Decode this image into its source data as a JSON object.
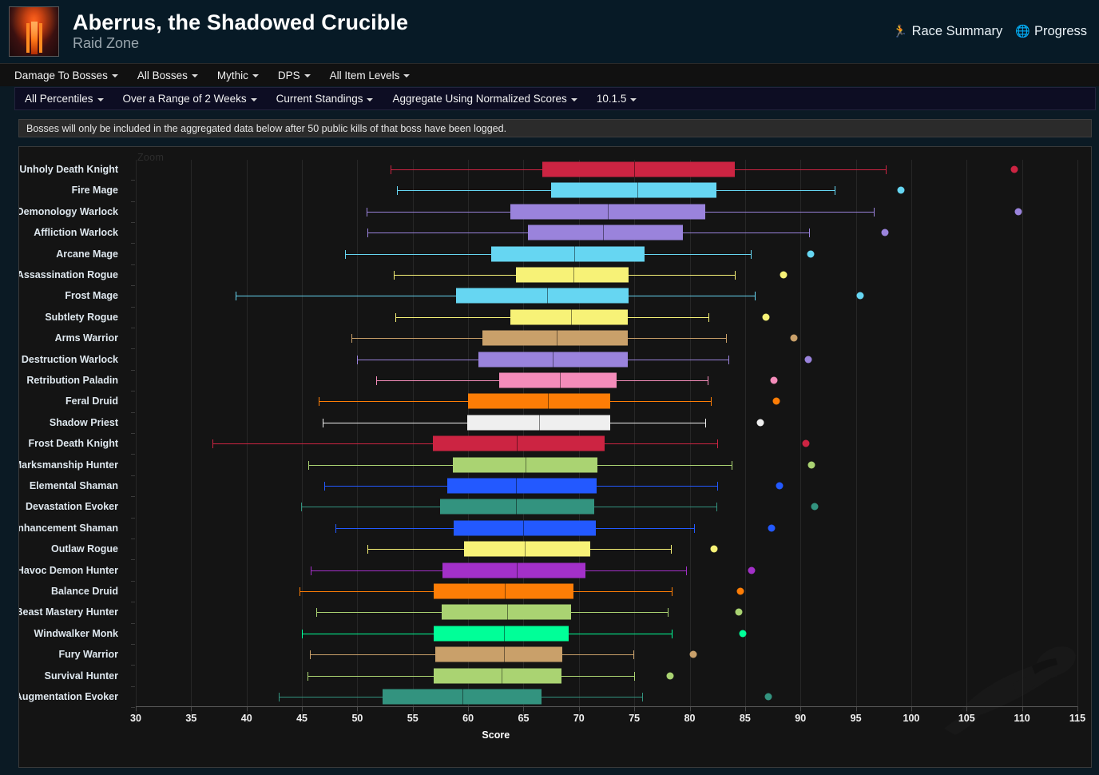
{
  "header": {
    "title": "Aberrus, the Shadowed Crucible",
    "subtitle": "Raid Zone",
    "zone_icon": "raid-zone-icon",
    "links": [
      {
        "label": "Race Summary",
        "icon": "runner-icon",
        "glyph": "🏃"
      },
      {
        "label": "Progress",
        "icon": "globe-icon",
        "glyph": "🌐"
      }
    ]
  },
  "filters_primary": [
    {
      "label": "Damage To Bosses"
    },
    {
      "label": "All Bosses"
    },
    {
      "label": "Mythic"
    },
    {
      "label": "DPS"
    },
    {
      "label": "All Item Levels"
    }
  ],
  "filters_secondary": [
    {
      "label": "All Percentiles"
    },
    {
      "label": "Over a Range of 2 Weeks"
    },
    {
      "label": "Current Standings"
    },
    {
      "label": "Aggregate Using Normalized Scores"
    },
    {
      "label": "10.1.5"
    }
  ],
  "notice": "Bosses will only be included in the aggregated data below after 50 public kills of that boss have been logged.",
  "chart_controls": {
    "zoom_label": "Zoom"
  },
  "chart_data": {
    "type": "box",
    "title": "",
    "xlabel": "Score",
    "ylabel": "",
    "xlim": [
      30,
      115
    ],
    "xticks": [
      30,
      35,
      40,
      45,
      50,
      55,
      60,
      65,
      70,
      75,
      80,
      85,
      90,
      95,
      100,
      105,
      110,
      115
    ],
    "grid": true,
    "legend": "none",
    "orientation": "horizontal",
    "categories": [
      "Unholy Death Knight",
      "Fire Mage",
      "Demonology Warlock",
      "Affliction Warlock",
      "Arcane Mage",
      "Assassination Rogue",
      "Frost Mage",
      "Subtlety Rogue",
      "Arms Warrior",
      "Destruction Warlock",
      "Retribution Paladin",
      "Feral Druid",
      "Shadow Priest",
      "Frost Death Knight",
      "Marksmanship Hunter",
      "Elemental Shaman",
      "Devastation Evoker",
      "Enhancement Shaman",
      "Outlaw Rogue",
      "Havoc Demon Hunter",
      "Balance Druid",
      "Beast Mastery Hunter",
      "Windwalker Monk",
      "Fury Warrior",
      "Survival Hunter",
      "Augmentation Evoker"
    ],
    "series": [
      {
        "name": "Unholy Death Knight",
        "color": "#cc2442",
        "low": 53.0,
        "q1": 66.7,
        "median": 75.0,
        "q3": 84.1,
        "high": 97.7,
        "outliers": [
          109.3
        ]
      },
      {
        "name": "Fire Mage",
        "color": "#66d6f2",
        "low": 53.6,
        "q1": 67.5,
        "median": 75.3,
        "q3": 82.4,
        "high": 93.1,
        "outliers": [
          99.1
        ]
      },
      {
        "name": "Demonology Warlock",
        "color": "#9a83dc",
        "low": 50.8,
        "q1": 63.8,
        "median": 72.6,
        "q3": 81.4,
        "high": 96.6,
        "outliers": [
          109.7
        ]
      },
      {
        "name": "Affliction Warlock",
        "color": "#9a83dc",
        "low": 50.9,
        "q1": 65.4,
        "median": 72.2,
        "q3": 79.4,
        "high": 90.8,
        "outliers": [
          97.6
        ]
      },
      {
        "name": "Arcane Mage",
        "color": "#66d6f2",
        "low": 48.9,
        "q1": 62.1,
        "median": 69.6,
        "q3": 75.9,
        "high": 85.5,
        "outliers": [
          90.9
        ]
      },
      {
        "name": "Assassination Rogue",
        "color": "#f7f277",
        "low": 53.3,
        "q1": 64.3,
        "median": 69.5,
        "q3": 74.5,
        "high": 84.1,
        "outliers": [
          88.5
        ]
      },
      {
        "name": "Frost Mage",
        "color": "#66d6f2",
        "low": 39.0,
        "q1": 58.9,
        "median": 67.1,
        "q3": 74.5,
        "high": 85.9,
        "outliers": [
          95.4
        ]
      },
      {
        "name": "Subtlety Rogue",
        "color": "#f7f277",
        "low": 53.4,
        "q1": 63.8,
        "median": 69.3,
        "q3": 74.4,
        "high": 81.7,
        "outliers": [
          86.9
        ]
      },
      {
        "name": "Arms Warrior",
        "color": "#c9a06a",
        "low": 49.5,
        "q1": 61.3,
        "median": 68.0,
        "q3": 74.4,
        "high": 83.3,
        "outliers": [
          89.4
        ]
      },
      {
        "name": "Destruction Warlock",
        "color": "#9a83dc",
        "low": 50.0,
        "q1": 60.9,
        "median": 67.6,
        "q3": 74.4,
        "high": 83.5,
        "outliers": [
          90.7
        ]
      },
      {
        "name": "Retribution Paladin",
        "color": "#f48cba",
        "low": 51.7,
        "q1": 62.8,
        "median": 68.3,
        "q3": 73.4,
        "high": 81.6,
        "outliers": [
          87.6
        ]
      },
      {
        "name": "Feral Druid",
        "color": "#fd7d06",
        "low": 46.5,
        "q1": 60.0,
        "median": 67.2,
        "q3": 72.8,
        "high": 81.9,
        "outliers": [
          87.8
        ]
      },
      {
        "name": "Shadow Priest",
        "color": "#efefef",
        "low": 46.9,
        "q1": 59.9,
        "median": 66.4,
        "q3": 72.8,
        "high": 81.4,
        "outliers": [
          86.4
        ]
      },
      {
        "name": "Frost Death Knight",
        "color": "#cc2442",
        "low": 36.9,
        "q1": 56.8,
        "median": 64.4,
        "q3": 72.3,
        "high": 82.5,
        "outliers": [
          90.5
        ]
      },
      {
        "name": "Marksmanship Hunter",
        "color": "#aad372",
        "low": 45.6,
        "q1": 58.6,
        "median": 65.2,
        "q3": 71.7,
        "high": 83.8,
        "outliers": [
          91.0
        ]
      },
      {
        "name": "Elemental Shaman",
        "color": "#2359ff",
        "low": 47.0,
        "q1": 58.1,
        "median": 64.3,
        "q3": 71.6,
        "high": 82.5,
        "outliers": [
          88.1
        ]
      },
      {
        "name": "Devastation Evoker",
        "color": "#33937f",
        "low": 44.9,
        "q1": 57.5,
        "median": 64.3,
        "q3": 71.4,
        "high": 82.4,
        "outliers": [
          91.3
        ]
      },
      {
        "name": "Enhancement Shaman",
        "color": "#2359ff",
        "low": 48.0,
        "q1": 58.7,
        "median": 65.0,
        "q3": 71.5,
        "high": 80.4,
        "outliers": [
          87.4
        ]
      },
      {
        "name": "Outlaw Rogue",
        "color": "#f7f277",
        "low": 50.9,
        "q1": 59.6,
        "median": 65.1,
        "q3": 71.0,
        "high": 78.3,
        "outliers": [
          82.2
        ]
      },
      {
        "name": "Havoc Demon Hunter",
        "color": "#a330c9",
        "low": 45.8,
        "q1": 57.7,
        "median": 64.4,
        "q3": 70.6,
        "high": 79.7,
        "outliers": [
          85.6
        ]
      },
      {
        "name": "Balance Druid",
        "color": "#fd7d06",
        "low": 44.8,
        "q1": 56.9,
        "median": 63.3,
        "q3": 69.5,
        "high": 78.4,
        "outliers": [
          84.6
        ]
      },
      {
        "name": "Beast Mastery Hunter",
        "color": "#aad372",
        "low": 46.3,
        "q1": 57.6,
        "median": 63.5,
        "q3": 69.3,
        "high": 78.0,
        "outliers": [
          84.4
        ]
      },
      {
        "name": "Windwalker Monk",
        "color": "#00ff98",
        "low": 45.0,
        "q1": 56.9,
        "median": 63.2,
        "q3": 69.1,
        "high": 78.4,
        "outliers": [
          84.8
        ]
      },
      {
        "name": "Fury Warrior",
        "color": "#c9a06a",
        "low": 45.7,
        "q1": 57.0,
        "median": 63.2,
        "q3": 68.5,
        "high": 74.9,
        "outliers": [
          80.3
        ]
      },
      {
        "name": "Survival Hunter",
        "color": "#aad372",
        "low": 45.5,
        "q1": 56.9,
        "median": 63.0,
        "q3": 68.4,
        "high": 75.0,
        "outliers": [
          78.2
        ]
      },
      {
        "name": "Augmentation Evoker",
        "color": "#33937f",
        "low": 42.9,
        "q1": 52.3,
        "median": 59.5,
        "q3": 66.6,
        "high": 75.7,
        "outliers": [
          87.1
        ]
      }
    ]
  }
}
